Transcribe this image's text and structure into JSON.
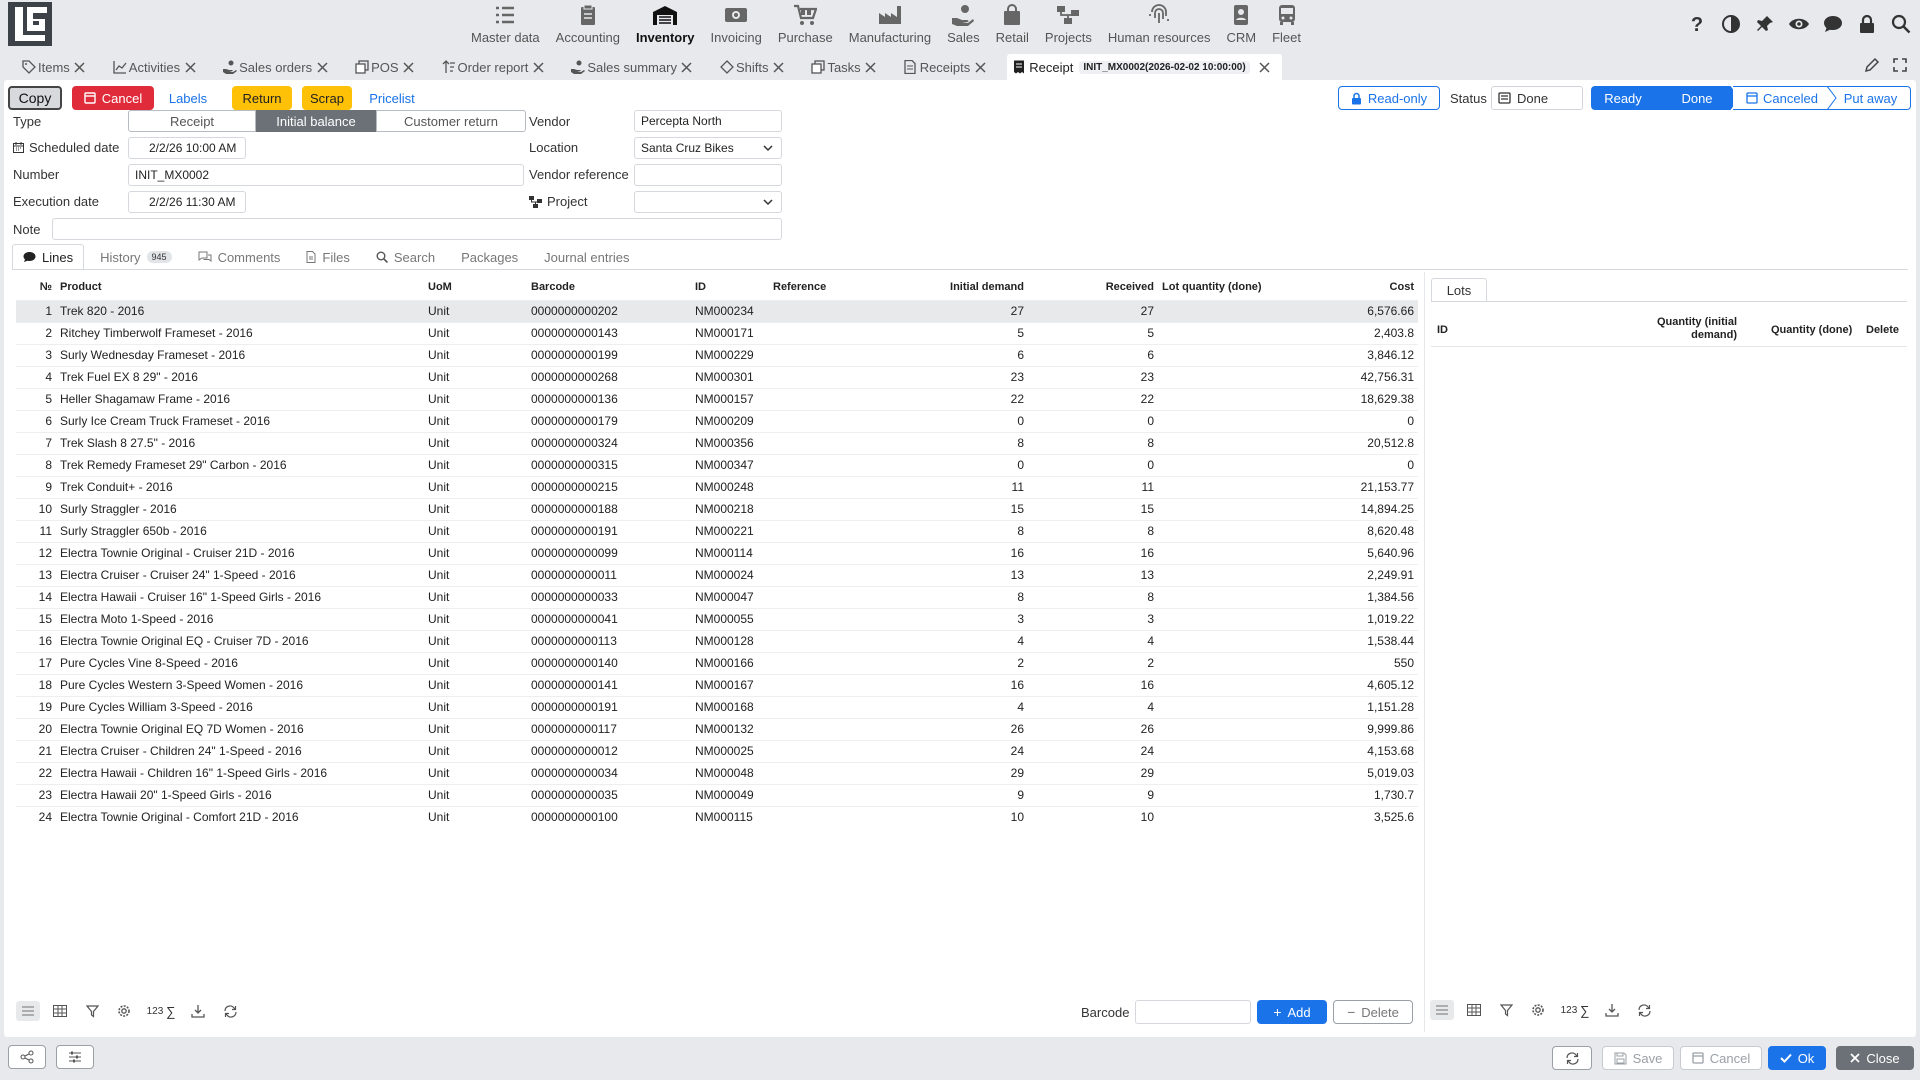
{
  "modules": [
    {
      "label": "Master data",
      "icon": "list-icon",
      "active": false
    },
    {
      "label": "Accounting",
      "icon": "clipboard-icon",
      "active": false
    },
    {
      "label": "Inventory",
      "icon": "warehouse-icon",
      "active": true
    },
    {
      "label": "Invoicing",
      "icon": "money-icon",
      "active": false
    },
    {
      "label": "Purchase",
      "icon": "cart-icon",
      "active": false
    },
    {
      "label": "Manufacturing",
      "icon": "factory-icon",
      "active": false
    },
    {
      "label": "Sales",
      "icon": "hand-coin-icon",
      "active": false
    },
    {
      "label": "Retail",
      "icon": "bag-icon",
      "active": false
    },
    {
      "label": "Projects",
      "icon": "sitemap-icon",
      "active": false
    },
    {
      "label": "Human resources",
      "icon": "fingerprint-icon",
      "active": false
    },
    {
      "label": "CRM",
      "icon": "contact-icon",
      "active": false
    },
    {
      "label": "Fleet",
      "icon": "bus-icon",
      "active": false
    }
  ],
  "tabs": [
    {
      "label": "Items",
      "icon": "tag-icon"
    },
    {
      "label": "Activities",
      "icon": "chart-icon"
    },
    {
      "label": "Sales orders",
      "icon": "hand-icon"
    },
    {
      "label": "POS",
      "icon": "copy-icon"
    },
    {
      "label": "Order report",
      "icon": "sort-icon"
    },
    {
      "label": "Sales summary",
      "icon": "hand-icon"
    },
    {
      "label": "Shifts",
      "icon": "diamond-icon"
    },
    {
      "label": "Tasks",
      "icon": "copy-icon"
    },
    {
      "label": "Receipts",
      "icon": "doc-icon"
    }
  ],
  "active_tab": {
    "label": "Receipt",
    "badge": "INIT_MX0002(2026-02-02 10:00:00)"
  },
  "toolbar": {
    "copy": "Copy",
    "cancel": "Cancel",
    "labels": "Labels",
    "return": "Return",
    "scrap": "Scrap",
    "pricelist": "Pricelist",
    "readonly": "Read-only",
    "status_label": "Status",
    "status_value": "Done"
  },
  "flow": {
    "ready": "Ready",
    "done": "Done",
    "canceled": "Canceled",
    "put_away": "Put away"
  },
  "form": {
    "type_label": "Type",
    "type_options": [
      "Receipt",
      "Initial balance",
      "Customer return"
    ],
    "scheduled_label": "Scheduled date",
    "scheduled_value": "2/2/26 10:00 AM",
    "number_label": "Number",
    "number_value": "INIT_MX0002",
    "execution_label": "Execution date",
    "execution_value": "2/2/26 11:30 AM",
    "note_label": "Note",
    "note_value": "",
    "vendor_label": "Vendor",
    "vendor_value": "Percepta North",
    "location_label": "Location",
    "location_value": "Santa Cruz Bikes",
    "vendor_ref_label": "Vendor reference",
    "vendor_ref_value": "",
    "project_label": "Project",
    "project_value": ""
  },
  "subtabs": {
    "lines": "Lines",
    "history": "History",
    "history_count": "945",
    "comments": "Comments",
    "files": "Files",
    "search": "Search",
    "packages": "Packages",
    "journal": "Journal entries"
  },
  "columns": {
    "no": "№",
    "product": "Product",
    "uom": "UoM",
    "barcode": "Barcode",
    "id": "ID",
    "reference": "Reference",
    "initial_demand": "Initial demand",
    "received": "Received",
    "lot_qty": "Lot quantity (done)",
    "cost": "Cost"
  },
  "rows": [
    [
      "1",
      "Trek 820 - 2016",
      "Unit",
      "0000000000202",
      "NM000234",
      "",
      "27",
      "27",
      "",
      "6,576.66"
    ],
    [
      "2",
      "Ritchey Timberwolf Frameset - 2016",
      "Unit",
      "0000000000143",
      "NM000171",
      "",
      "5",
      "5",
      "",
      "2,403.8"
    ],
    [
      "3",
      "Surly Wednesday Frameset - 2016",
      "Unit",
      "0000000000199",
      "NM000229",
      "",
      "6",
      "6",
      "",
      "3,846.12"
    ],
    [
      "4",
      "Trek Fuel EX 8 29\" - 2016",
      "Unit",
      "0000000000268",
      "NM000301",
      "",
      "23",
      "23",
      "",
      "42,756.31"
    ],
    [
      "5",
      "Heller Shagamaw Frame - 2016",
      "Unit",
      "0000000000136",
      "NM000157",
      "",
      "22",
      "22",
      "",
      "18,629.38"
    ],
    [
      "6",
      "Surly Ice Cream Truck Frameset - 2016",
      "Unit",
      "0000000000179",
      "NM000209",
      "",
      "0",
      "0",
      "",
      "0"
    ],
    [
      "7",
      "Trek Slash 8 27.5\" - 2016",
      "Unit",
      "0000000000324",
      "NM000356",
      "",
      "8",
      "8",
      "",
      "20,512.8"
    ],
    [
      "8",
      "Trek Remedy Frameset 29\" Carbon - 2016",
      "Unit",
      "0000000000315",
      "NM000347",
      "",
      "0",
      "0",
      "",
      "0"
    ],
    [
      "9",
      "Trek Conduit+ - 2016",
      "Unit",
      "0000000000215",
      "NM000248",
      "",
      "11",
      "11",
      "",
      "21,153.77"
    ],
    [
      "10",
      "Surly Straggler - 2016",
      "Unit",
      "0000000000188",
      "NM000218",
      "",
      "15",
      "15",
      "",
      "14,894.25"
    ],
    [
      "11",
      "Surly Straggler 650b - 2016",
      "Unit",
      "0000000000191",
      "NM000221",
      "",
      "8",
      "8",
      "",
      "8,620.48"
    ],
    [
      "12",
      "Electra Townie Original - Cruiser 21D - 2016",
      "Unit",
      "0000000000099",
      "NM000114",
      "",
      "16",
      "16",
      "",
      "5,640.96"
    ],
    [
      "13",
      "Electra Cruiser - Cruiser 24\" 1-Speed - 2016",
      "Unit",
      "0000000000011",
      "NM000024",
      "",
      "13",
      "13",
      "",
      "2,249.91"
    ],
    [
      "14",
      "Electra Hawaii - Cruiser 16\" 1-Speed Girls - 2016",
      "Unit",
      "0000000000033",
      "NM000047",
      "",
      "8",
      "8",
      "",
      "1,384.56"
    ],
    [
      "15",
      "Electra Moto 1-Speed - 2016",
      "Unit",
      "0000000000041",
      "NM000055",
      "",
      "3",
      "3",
      "",
      "1,019.22"
    ],
    [
      "16",
      "Electra Townie Original EQ - Cruiser 7D - 2016",
      "Unit",
      "0000000000113",
      "NM000128",
      "",
      "4",
      "4",
      "",
      "1,538.44"
    ],
    [
      "17",
      "Pure Cycles Vine 8-Speed - 2016",
      "Unit",
      "0000000000140",
      "NM000166",
      "",
      "2",
      "2",
      "",
      "550"
    ],
    [
      "18",
      "Pure Cycles Western 3-Speed Women - 2016",
      "Unit",
      "0000000000141",
      "NM000167",
      "",
      "16",
      "16",
      "",
      "4,605.12"
    ],
    [
      "19",
      "Pure Cycles William 3-Speed - 2016",
      "Unit",
      "0000000000191",
      "NM000168",
      "",
      "4",
      "4",
      "",
      "1,151.28"
    ],
    [
      "20",
      "Electra Townie Original EQ 7D Women - 2016",
      "Unit",
      "0000000000117",
      "NM000132",
      "",
      "26",
      "26",
      "",
      "9,999.86"
    ],
    [
      "21",
      "Electra Cruiser - Children 24\" 1-Speed - 2016",
      "Unit",
      "0000000000012",
      "NM000025",
      "",
      "24",
      "24",
      "",
      "4,153.68"
    ],
    [
      "22",
      "Electra Hawaii - Children 16\" 1-Speed Girls - 2016",
      "Unit",
      "0000000000034",
      "NM000048",
      "",
      "29",
      "29",
      "",
      "5,019.03"
    ],
    [
      "23",
      "Electra Hawaii 20\" 1-Speed Girls - 2016",
      "Unit",
      "0000000000035",
      "NM000049",
      "",
      "9",
      "9",
      "",
      "1,730.7"
    ],
    [
      "24",
      "Electra Townie Original - Comfort 21D - 2016",
      "Unit",
      "0000000000100",
      "NM000115",
      "",
      "10",
      "10",
      "",
      "3,525.6"
    ]
  ],
  "grid_footer": {
    "count_label": "123",
    "barcode_label": "Barcode",
    "add": "Add",
    "delete": "Delete"
  },
  "lots": {
    "tab": "Lots",
    "id": "ID",
    "qty_initial": "Quantity (initial demand)",
    "qty_done": "Quantity (done)",
    "delete": "Delete",
    "count_label": "123"
  },
  "bottom": {
    "save": "Save",
    "cancel": "Cancel",
    "ok": "Ok",
    "close": "Close"
  },
  "colors": {
    "accent": "#1a73e8",
    "danger": "#e02b3a",
    "warning": "#ffc107",
    "dark": "#6b7177"
  }
}
